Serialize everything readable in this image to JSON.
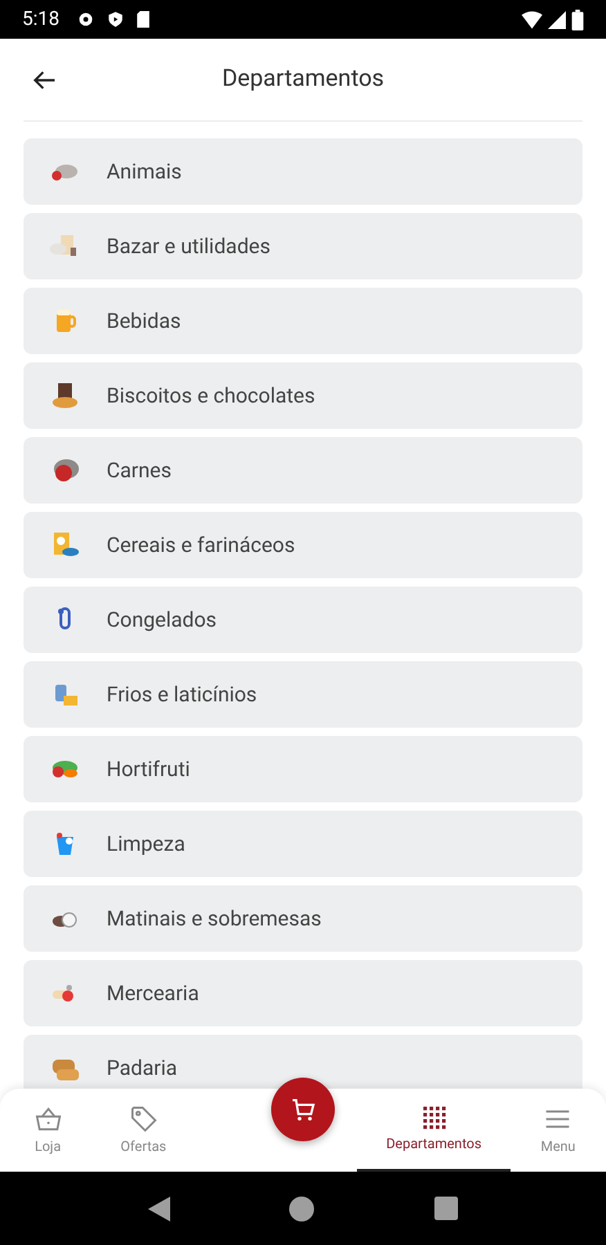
{
  "status_bar": {
    "time": "5:18"
  },
  "header": {
    "title": "Departamentos"
  },
  "departments": [
    {
      "label": "Animais"
    },
    {
      "label": "Bazar e utilidades"
    },
    {
      "label": "Bebidas"
    },
    {
      "label": "Biscoitos e chocolates"
    },
    {
      "label": "Carnes"
    },
    {
      "label": "Cereais e farináceos"
    },
    {
      "label": "Congelados"
    },
    {
      "label": "Frios e laticínios"
    },
    {
      "label": "Hortifruti"
    },
    {
      "label": "Limpeza"
    },
    {
      "label": "Matinais e sobremesas"
    },
    {
      "label": "Mercearia"
    },
    {
      "label": "Padaria"
    }
  ],
  "bottom_nav": [
    {
      "label": "Loja",
      "selected": false
    },
    {
      "label": "Ofertas",
      "selected": false
    },
    {
      "label": "Departamentos",
      "selected": true
    },
    {
      "label": "Menu",
      "selected": false
    }
  ]
}
